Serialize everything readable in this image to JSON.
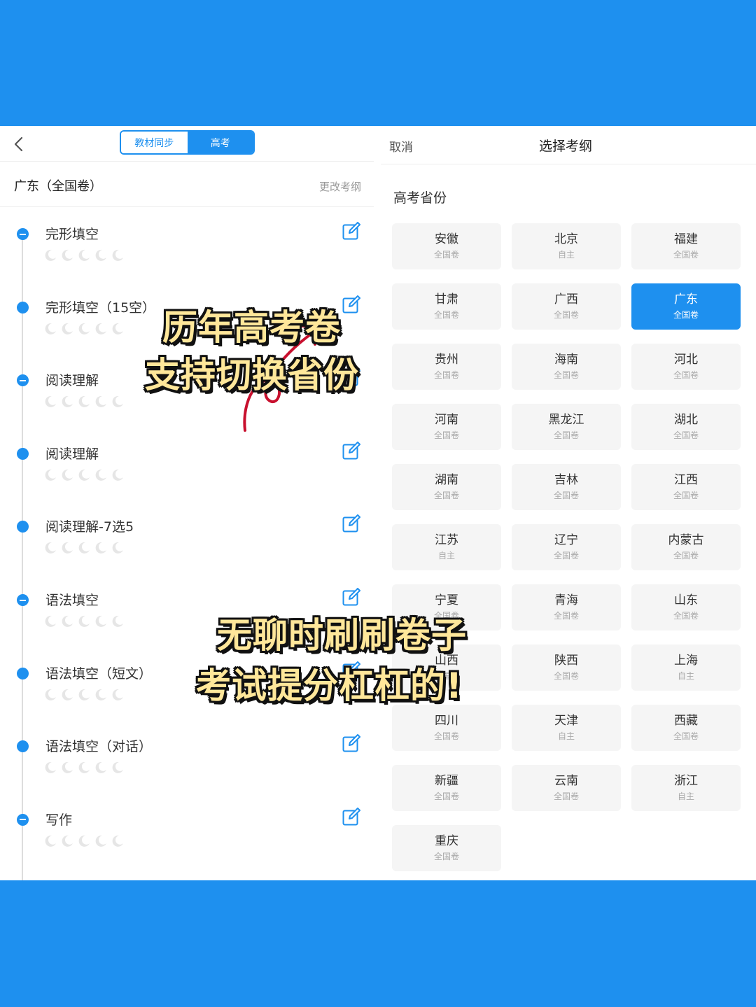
{
  "left_panel": {
    "segment_tabs": [
      {
        "label": "教材同步",
        "active": false
      },
      {
        "label": "高考",
        "active": true
      }
    ],
    "region_label": "广东（全国卷）",
    "change_link": "更改考纲",
    "items": [
      {
        "title": "完形填空",
        "icon": "minus-circle-icon",
        "rating": 0
      },
      {
        "title": "完形填空（15空）",
        "icon": "dot-icon",
        "rating": 0
      },
      {
        "title": "阅读理解",
        "icon": "minus-circle-icon",
        "rating": 0
      },
      {
        "title": "阅读理解",
        "icon": "dot-icon",
        "rating": 0
      },
      {
        "title": "阅读理解-7选5",
        "icon": "dot-icon",
        "rating": 0
      },
      {
        "title": "语法填空",
        "icon": "minus-circle-icon",
        "rating": 0
      },
      {
        "title": "语法填空（短文）",
        "icon": "dot-icon",
        "rating": 0
      },
      {
        "title": "语法填空（对话）",
        "icon": "dot-icon",
        "rating": 0
      },
      {
        "title": "写作",
        "icon": "minus-circle-icon",
        "rating": 0
      }
    ]
  },
  "right_panel": {
    "cancel_label": "取消",
    "title": "选择考纲",
    "section_label": "高考省份",
    "provinces": [
      {
        "name": "安徽",
        "type": "全国卷",
        "selected": false
      },
      {
        "name": "北京",
        "type": "自主",
        "selected": false
      },
      {
        "name": "福建",
        "type": "全国卷",
        "selected": false
      },
      {
        "name": "甘肃",
        "type": "全国卷",
        "selected": false
      },
      {
        "name": "广西",
        "type": "全国卷",
        "selected": false
      },
      {
        "name": "广东",
        "type": "全国卷",
        "selected": true
      },
      {
        "name": "贵州",
        "type": "全国卷",
        "selected": false
      },
      {
        "name": "海南",
        "type": "全国卷",
        "selected": false
      },
      {
        "name": "河北",
        "type": "全国卷",
        "selected": false
      },
      {
        "name": "河南",
        "type": "全国卷",
        "selected": false
      },
      {
        "name": "黑龙江",
        "type": "全国卷",
        "selected": false
      },
      {
        "name": "湖北",
        "type": "全国卷",
        "selected": false
      },
      {
        "name": "湖南",
        "type": "全国卷",
        "selected": false
      },
      {
        "name": "吉林",
        "type": "全国卷",
        "selected": false
      },
      {
        "name": "江西",
        "type": "全国卷",
        "selected": false
      },
      {
        "name": "江苏",
        "type": "自主",
        "selected": false
      },
      {
        "name": "辽宁",
        "type": "全国卷",
        "selected": false
      },
      {
        "name": "内蒙古",
        "type": "全国卷",
        "selected": false
      },
      {
        "name": "宁夏",
        "type": "全国卷",
        "selected": false
      },
      {
        "name": "青海",
        "type": "全国卷",
        "selected": false
      },
      {
        "name": "山东",
        "type": "全国卷",
        "selected": false
      },
      {
        "name": "山西",
        "type": "全国卷",
        "selected": false
      },
      {
        "name": "陕西",
        "type": "全国卷",
        "selected": false
      },
      {
        "name": "上海",
        "type": "自主",
        "selected": false
      },
      {
        "name": "四川",
        "type": "全国卷",
        "selected": false
      },
      {
        "name": "天津",
        "type": "自主",
        "selected": false
      },
      {
        "name": "西藏",
        "type": "全国卷",
        "selected": false
      },
      {
        "name": "新疆",
        "type": "全国卷",
        "selected": false
      },
      {
        "name": "云南",
        "type": "全国卷",
        "selected": false
      },
      {
        "name": "浙江",
        "type": "自主",
        "selected": false
      },
      {
        "name": "重庆",
        "type": "全国卷",
        "selected": false
      }
    ]
  },
  "overlay_text": {
    "line1": "历年高考卷",
    "line2": "支持切换省份",
    "line3": "无聊时刷刷卷子",
    "line4": "考试提分杠杠的!"
  },
  "colors": {
    "brand_blue": "#1e90ef",
    "overlay_fill": "#ffe79a",
    "annotation_arrow": "#c8102e"
  }
}
